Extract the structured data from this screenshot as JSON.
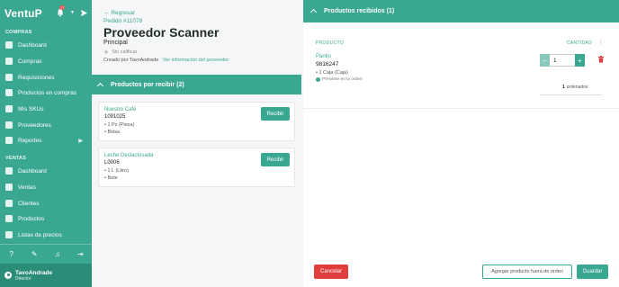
{
  "sidebar": {
    "brand": "VentuP",
    "notif_count": "17",
    "sections": {
      "compras": "COMPRAS",
      "ventas": "VENTAS"
    },
    "items": [
      {
        "label": "Dashboard",
        "icon": "dashboard-icon"
      },
      {
        "label": "Compras",
        "icon": "cart-icon"
      },
      {
        "label": "Requisiciones",
        "icon": "clipboard-icon"
      },
      {
        "label": "Productos en compras",
        "icon": "box-icon"
      },
      {
        "label": "Mis SKUs",
        "icon": "tag-icon"
      },
      {
        "label": "Proveedores",
        "icon": "truck-icon"
      },
      {
        "label": "Reportes",
        "icon": "chart-icon"
      },
      {
        "label": "Dashboard",
        "icon": "dashboard-icon"
      },
      {
        "label": "Ventas",
        "icon": "sales-icon"
      },
      {
        "label": "Clientes",
        "icon": "users-icon"
      },
      {
        "label": "Productos",
        "icon": "box-icon"
      },
      {
        "label": "Listas de precios",
        "icon": "list-icon"
      }
    ],
    "user": {
      "name": "TavoAndrade",
      "role": "Director"
    }
  },
  "left": {
    "back": "Regresar",
    "order": "Pedido #11078",
    "supplier": "Proveedor Scanner",
    "branch": "Principal",
    "rating": "Sin calificar",
    "created": "Creado por TavoAndrade",
    "supplier_info": "Ver información del proveedor",
    "pending_title": "Productos por recibir (2)",
    "receive_label": "Recibir",
    "cards": [
      {
        "name": "Nuestro Café",
        "code": "1091025",
        "unit": "1 Pz (Pieza)",
        "pack": "Bolsa"
      },
      {
        "name": "Leche Deslactosada",
        "code": "L0006",
        "unit": "1 L (Litro)",
        "pack": "Bote"
      }
    ]
  },
  "right": {
    "title": "Productos recibidos (1)",
    "col_product": "PRODUCTO",
    "col_qty": "CANTIDAD",
    "item": {
      "name": "Panko",
      "code": "9816247",
      "unit": "1 Caja (Caja)",
      "status": "Presente en la orden",
      "qty": "1",
      "ordered_count": "1",
      "ordered_label": "ordenados"
    },
    "cancel": "Cancelar",
    "add_outside": "Agregar producto fuera de orden",
    "save": "Guardar"
  }
}
